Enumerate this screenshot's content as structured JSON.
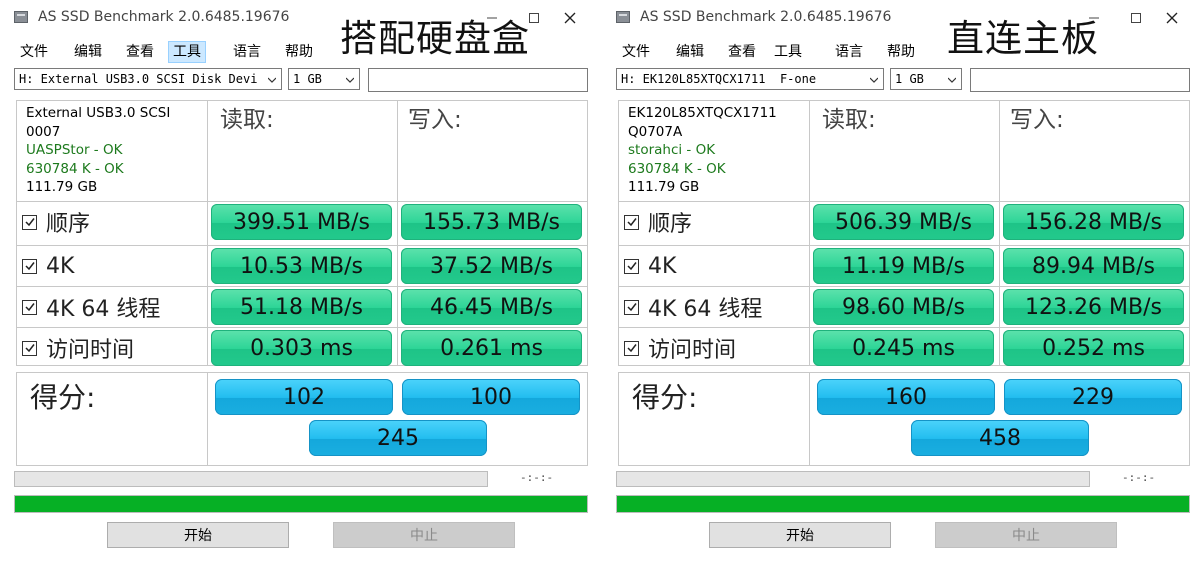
{
  "windows": [
    {
      "title": "AS SSD Benchmark 2.0.6485.19676",
      "overlay_label": "搭配硬盘盒",
      "menu": [
        "文件",
        "编辑",
        "查看",
        "工具",
        "语言",
        "帮助"
      ],
      "active_menu": "工具",
      "drive_select": "H: External USB3.0 SCSI Disk Devi",
      "size_select": "1 GB",
      "text_input": "",
      "info": [
        "External USB3.0 SCSI",
        "0007",
        "UASPStor - OK",
        "630784 K - OK",
        "111.79 GB"
      ],
      "read_header": "读取:",
      "write_header": "写入:",
      "rows": [
        {
          "label": "顺序",
          "read": "399.51 MB/s",
          "write": "155.73 MB/s"
        },
        {
          "label": "4K",
          "read": "10.53 MB/s",
          "write": "37.52 MB/s"
        },
        {
          "label": "4K 64 线程",
          "read": "51.18 MB/s",
          "write": "46.45 MB/s"
        },
        {
          "label": "访问时间",
          "read": "0.303 ms",
          "write": "0.261 ms"
        }
      ],
      "score_label": "得分:",
      "score_read": "102",
      "score_write": "100",
      "score_total": "245",
      "timer": "-:-:-",
      "progress": 1.0,
      "start_label": "开始",
      "stop_label": "中止"
    },
    {
      "title": "AS SSD Benchmark 2.0.6485.19676",
      "overlay_label": "直连主板",
      "menu": [
        "文件",
        "编辑",
        "查看",
        "工具",
        "语言",
        "帮助"
      ],
      "active_menu": "",
      "drive_select": "H: EK120L85XTQCX1711  F-one",
      "size_select": "1 GB",
      "text_input": "",
      "info": [
        "EK120L85XTQCX1711",
        "Q0707A",
        "storahci - OK",
        "630784 K - OK",
        "111.79 GB"
      ],
      "read_header": "读取:",
      "write_header": "写入:",
      "rows": [
        {
          "label": "顺序",
          "read": "506.39 MB/s",
          "write": "156.28 MB/s"
        },
        {
          "label": "4K",
          "read": "11.19 MB/s",
          "write": "89.94 MB/s"
        },
        {
          "label": "4K 64 线程",
          "read": "98.60 MB/s",
          "write": "123.26 MB/s"
        },
        {
          "label": "访问时间",
          "read": "0.245 ms",
          "write": "0.252 ms"
        }
      ],
      "score_label": "得分:",
      "score_read": "160",
      "score_write": "229",
      "score_total": "458",
      "timer": "-:-:-",
      "progress": 1.0,
      "start_label": "开始",
      "stop_label": "中止"
    }
  ],
  "colors": {
    "result_green": "#2dd597",
    "score_blue": "#22bdef",
    "progress_green": "#06b025",
    "ok_text": "#1d7a1d"
  },
  "icons": [
    "app-icon",
    "minimize-icon",
    "maximize-icon",
    "close-icon",
    "chevron-down-icon",
    "checkbox-checked-icon"
  ]
}
